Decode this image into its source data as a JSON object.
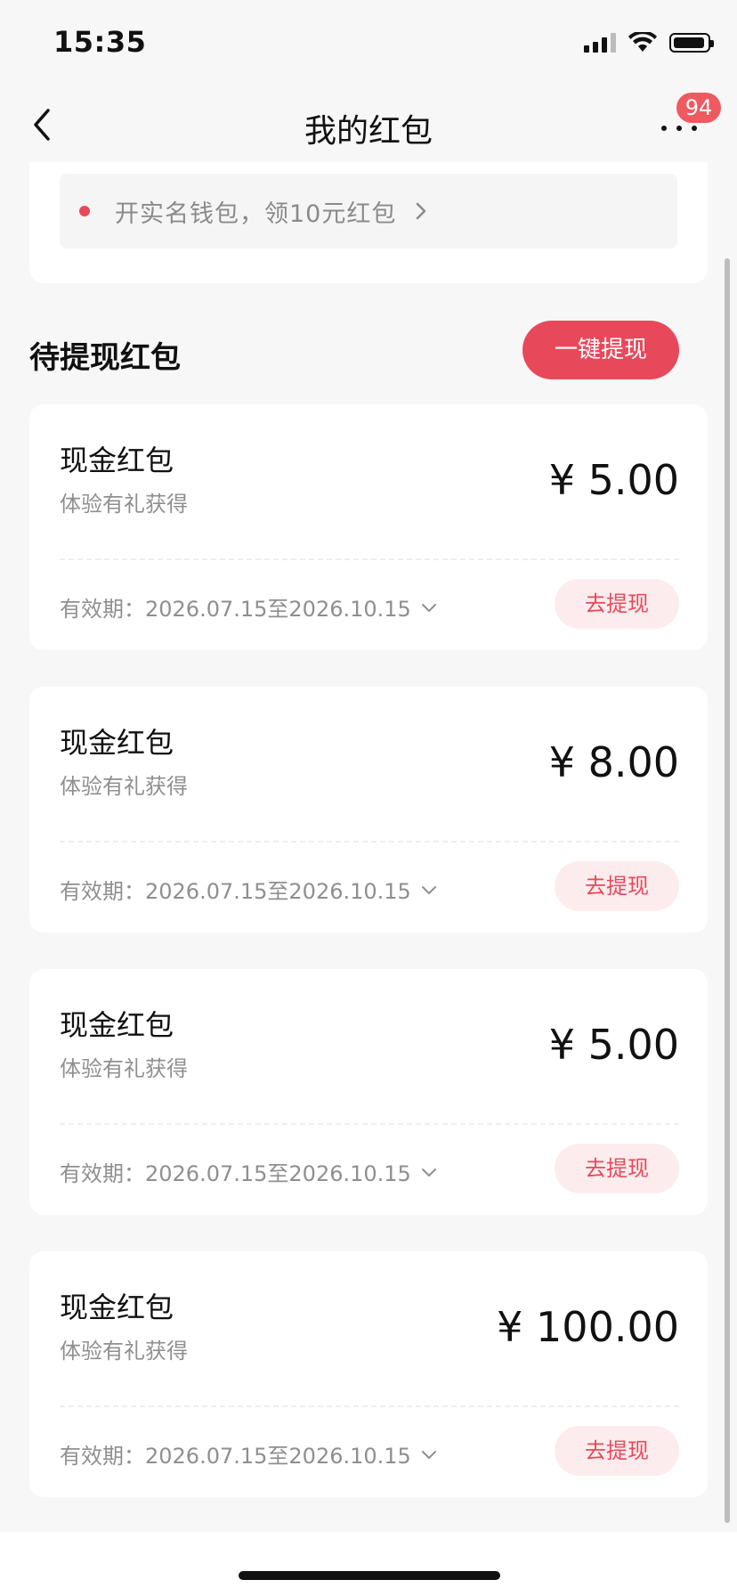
{
  "status_bar": {
    "time": "15:35"
  },
  "nav": {
    "title": "我的红包",
    "badge_count": "94"
  },
  "banner": {
    "text": "开实名钱包，领10元红包"
  },
  "section": {
    "title": "待提现红包",
    "withdraw_all_label": "一键提现"
  },
  "cards": [
    {
      "name": "现金红包",
      "source": "体验有礼获得",
      "amount": "¥ 5.00",
      "validity": "有效期：2026.07.15至2026.10.15",
      "button_label": "去提现"
    },
    {
      "name": "现金红包",
      "source": "体验有礼获得",
      "amount": "¥ 8.00",
      "validity": "有效期：2026.07.15至2026.10.15",
      "button_label": "去提现"
    },
    {
      "name": "现金红包",
      "source": "体验有礼获得",
      "amount": "¥ 5.00",
      "validity": "有效期：2026.07.15至2026.10.15",
      "button_label": "去提现"
    },
    {
      "name": "现金红包",
      "source": "体验有礼获得",
      "amount": "¥ 100.00",
      "validity": "有效期：2026.07.15至2026.10.15",
      "button_label": "去提现"
    }
  ],
  "icons": {
    "back": "chevron-left-icon",
    "more": "more-dots-icon",
    "banner_arrow": "chevron-right-icon",
    "validity_toggle": "chevron-down-icon"
  },
  "colors": {
    "accent": "#e8495a",
    "accent_light": "#fdecee",
    "badge": "#ee5a5f"
  }
}
